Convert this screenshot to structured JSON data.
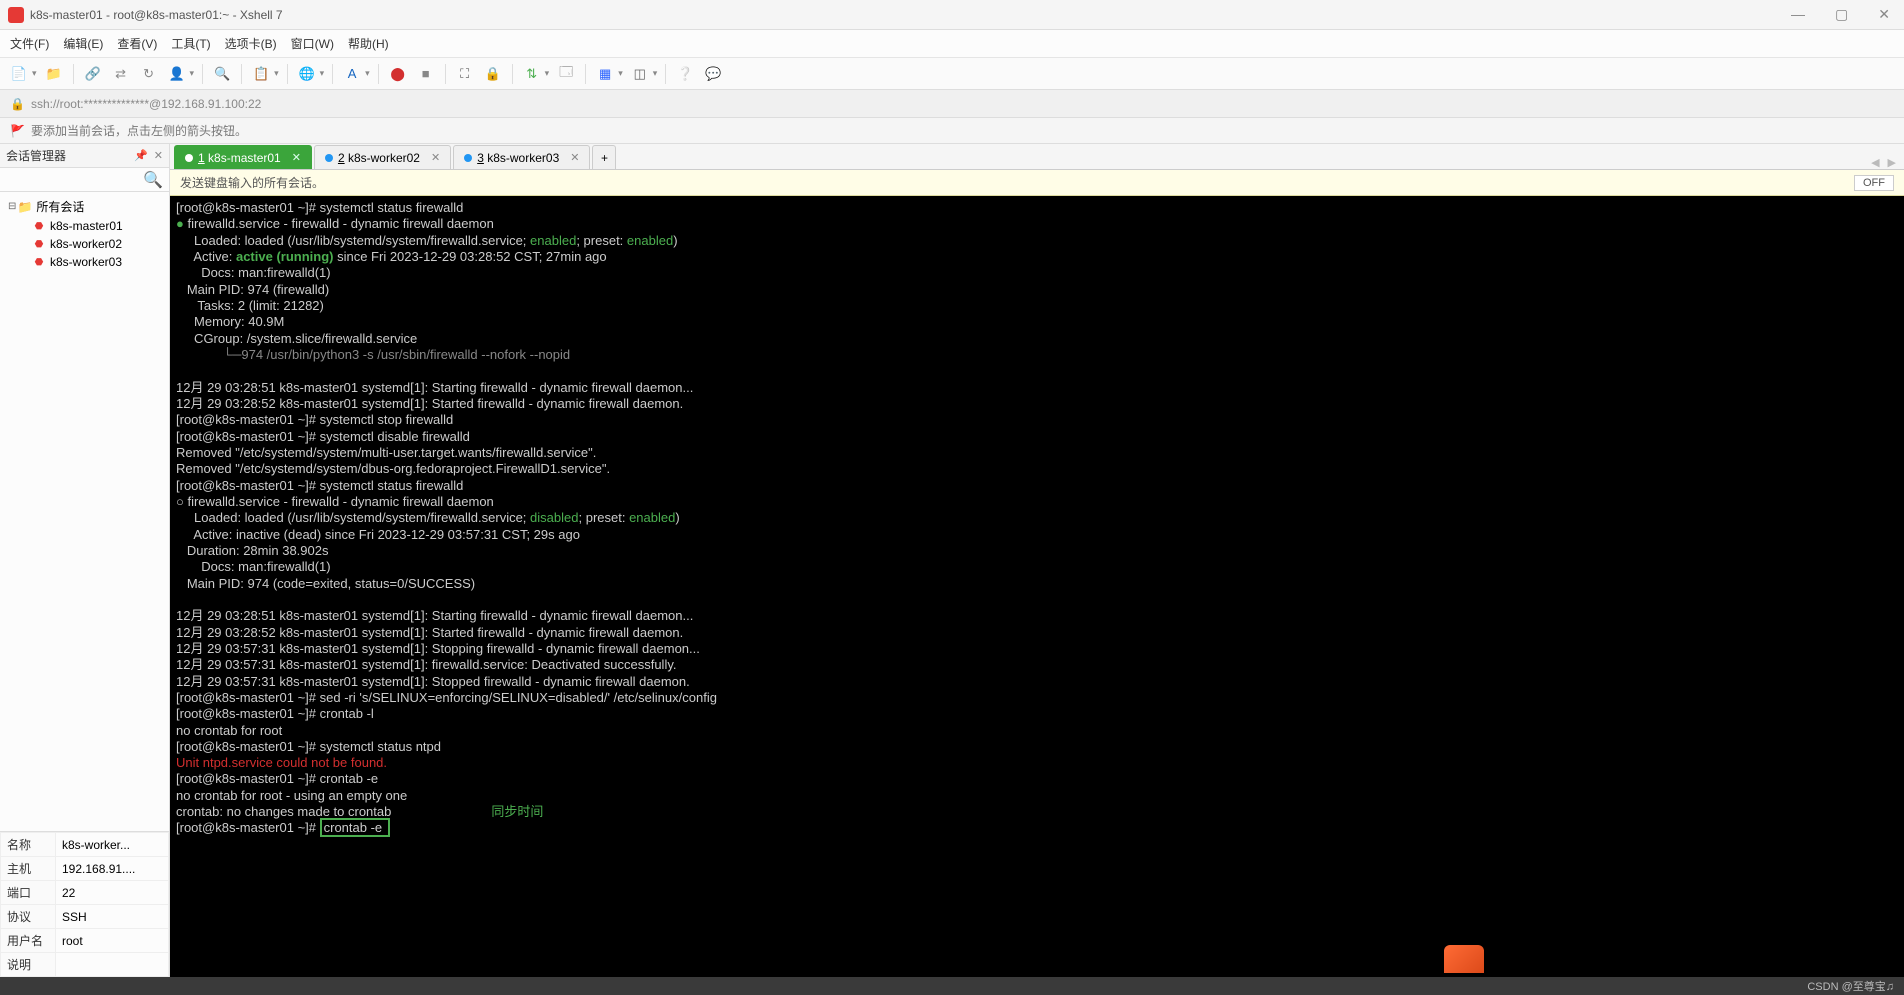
{
  "window": {
    "title": "k8s-master01 - root@k8s-master01:~ - Xshell 7",
    "minimize": "—",
    "maximize": "▢",
    "close": "✕"
  },
  "menu": {
    "file": "文件(F)",
    "edit": "编辑(E)",
    "view": "查看(V)",
    "tools": "工具(T)",
    "tabs": "选项卡(B)",
    "window": "窗口(W)",
    "help": "帮助(H)"
  },
  "address": {
    "url": "ssh://root:**************@192.168.91.100:22"
  },
  "info": {
    "tip": "要添加当前会话，点击左侧的箭头按钮。"
  },
  "session_mgr": {
    "title": "会话管理器",
    "root": "所有会话",
    "items": [
      "k8s-master01",
      "k8s-worker02",
      "k8s-worker03"
    ]
  },
  "props": {
    "name_label": "名称",
    "name_val": "k8s-worker...",
    "host_label": "主机",
    "host_val": "192.168.91....",
    "port_label": "端口",
    "port_val": "22",
    "proto_label": "协议",
    "proto_val": "SSH",
    "user_label": "用户名",
    "user_val": "root",
    "desc_label": "说明",
    "desc_val": ""
  },
  "tabs": {
    "t1": "1 k8s-master01",
    "t2": "2 k8s-worker02",
    "t3": "3 k8s-worker03"
  },
  "banner": {
    "text": "发送键盘输入的所有会话。",
    "off": "OFF"
  },
  "terminal": {
    "l1": "[root@k8s-master01 ~]# systemctl status firewalld",
    "l2a": "●",
    "l2b": " firewalld.service - firewalld - dynamic firewall daemon",
    "l3a": "     Loaded: loaded (/usr/lib/systemd/system/firewalld.service; ",
    "l3b": "enabled",
    "l3c": "; preset: ",
    "l3d": "enabled",
    "l3e": ")",
    "l4a": "     Active: ",
    "l4b": "active (running)",
    "l4c": " since Fri 2023-12-29 03:28:52 CST; 27min ago",
    "l5": "       Docs: man:firewalld(1)",
    "l6": "   Main PID: 974 (firewalld)",
    "l7": "      Tasks: 2 (limit: 21282)",
    "l8": "     Memory: 40.9M",
    "l9": "     CGroup: /system.slice/firewalld.service",
    "l10": "             └─974 /usr/bin/python3 -s /usr/sbin/firewalld --nofork --nopid",
    "l11": "",
    "l12": "12月 29 03:28:51 k8s-master01 systemd[1]: Starting firewalld - dynamic firewall daemon...",
    "l13": "12月 29 03:28:52 k8s-master01 systemd[1]: Started firewalld - dynamic firewall daemon.",
    "l14": "[root@k8s-master01 ~]# systemctl stop firewalld",
    "l15": "[root@k8s-master01 ~]# systemctl disable firewalld",
    "l16": "Removed \"/etc/systemd/system/multi-user.target.wants/firewalld.service\".",
    "l17": "Removed \"/etc/systemd/system/dbus-org.fedoraproject.FirewallD1.service\".",
    "l18": "[root@k8s-master01 ~]# systemctl status firewalld",
    "l19": "○ firewalld.service - firewalld - dynamic firewall daemon",
    "l20a": "     Loaded: loaded (/usr/lib/systemd/system/firewalld.service; ",
    "l20b": "disabled",
    "l20c": "; preset: ",
    "l20d": "enabled",
    "l20e": ")",
    "l21": "     Active: inactive (dead) since Fri 2023-12-29 03:57:31 CST; 29s ago",
    "l22": "   Duration: 28min 38.902s",
    "l23": "       Docs: man:firewalld(1)",
    "l24": "   Main PID: 974 (code=exited, status=0/SUCCESS)",
    "l25": "",
    "l26": "12月 29 03:28:51 k8s-master01 systemd[1]: Starting firewalld - dynamic firewall daemon...",
    "l27": "12月 29 03:28:52 k8s-master01 systemd[1]: Started firewalld - dynamic firewall daemon.",
    "l28": "12月 29 03:57:31 k8s-master01 systemd[1]: Stopping firewalld - dynamic firewall daemon...",
    "l29": "12月 29 03:57:31 k8s-master01 systemd[1]: firewalld.service: Deactivated successfully.",
    "l30": "12月 29 03:57:31 k8s-master01 systemd[1]: Stopped firewalld - dynamic firewall daemon.",
    "l31": "[root@k8s-master01 ~]# sed -ri 's/SELINUX=enforcing/SELINUX=disabled/' /etc/selinux/config",
    "l32": "[root@k8s-master01 ~]# crontab -l",
    "l33": "no crontab for root",
    "l34": "[root@k8s-master01 ~]# systemctl status ntpd",
    "l35": "Unit ntpd.service could not be found.",
    "l36": "[root@k8s-master01 ~]# crontab -e",
    "l37": "no crontab for root - using an empty one",
    "l38": "crontab: no changes made to crontab",
    "l39a": "[root@k8s-master01 ~]# ",
    "l39b": "crontab -e ",
    "annotation": "同步时间"
  },
  "status": {
    "watermark": "CSDN @至尊宝♫"
  }
}
